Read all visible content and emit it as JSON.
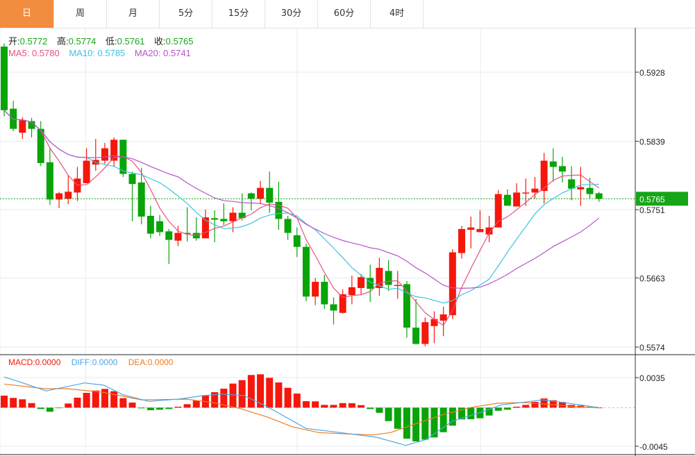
{
  "tabs": [
    {
      "label": "日",
      "active": true
    },
    {
      "label": "周",
      "active": false
    },
    {
      "label": "月",
      "active": false
    },
    {
      "label": "5分",
      "active": false
    },
    {
      "label": "15分",
      "active": false
    },
    {
      "label": "30分",
      "active": false
    },
    {
      "label": "60分",
      "active": false
    },
    {
      "label": "4时",
      "active": false
    }
  ],
  "ohlc_legend": {
    "open_label": "开:",
    "open": "0.5772",
    "high_label": "高:",
    "high": "0.5774",
    "low_label": "低:",
    "low": "0.5761",
    "close_label": "收:",
    "close": "0.5765"
  },
  "ma_legend": {
    "ma5": "MA5: 0.5780",
    "ma10": "MA10: 0.5785",
    "ma20": "MA20: 0.5741"
  },
  "macd_legend": {
    "macd": "MACD:0.0000",
    "diff": "DIFF:0.0000",
    "dea": "DEA:0.0000"
  },
  "colors": {
    "up": "#f5170b",
    "down": "#08a408",
    "ma5": "#ea4f80",
    "ma10": "#3cc4dc",
    "ma20": "#b455c6",
    "diff": "#4aa6e8",
    "dea": "#f07c1c",
    "active_tab": "#f28c3f",
    "last_price_bg": "#16a516"
  },
  "chart_data": [
    {
      "type": "candlestick",
      "y_ticks": [
        "0.5928",
        "0.5839",
        "0.5751",
        "0.5663",
        "0.5574"
      ],
      "ylim": [
        0.5574,
        0.5928
      ],
      "last_price": "0.5765",
      "grid": true,
      "ohlc": [
        [
          0.5961,
          0.5965,
          0.5871,
          0.5879
        ],
        [
          0.5881,
          0.5891,
          0.5852,
          0.5855
        ],
        [
          0.585,
          0.587,
          0.5842,
          0.5866
        ],
        [
          0.5865,
          0.5869,
          0.5844,
          0.5855
        ],
        [
          0.5855,
          0.5865,
          0.5807,
          0.5811
        ],
        [
          0.5812,
          0.5831,
          0.5757,
          0.5764
        ],
        [
          0.5764,
          0.5774,
          0.5753,
          0.5772
        ],
        [
          0.5765,
          0.5795,
          0.5758,
          0.5774
        ],
        [
          0.5773,
          0.5806,
          0.5762,
          0.5791
        ],
        [
          0.5785,
          0.583,
          0.5785,
          0.5814
        ],
        [
          0.5809,
          0.5842,
          0.5801,
          0.5815
        ],
        [
          0.5814,
          0.5837,
          0.581,
          0.583
        ],
        [
          0.5814,
          0.5844,
          0.5806,
          0.5841
        ],
        [
          0.5841,
          0.5841,
          0.5793,
          0.5797
        ],
        [
          0.5797,
          0.58,
          0.5736,
          0.5784
        ],
        [
          0.5786,
          0.5805,
          0.5732,
          0.5742
        ],
        [
          0.5743,
          0.5756,
          0.5714,
          0.572
        ],
        [
          0.5736,
          0.5744,
          0.5717,
          0.5722
        ],
        [
          0.5723,
          0.5726,
          0.5681,
          0.5712
        ],
        [
          0.5711,
          0.573,
          0.5704,
          0.5721
        ],
        [
          0.5721,
          0.5754,
          0.571,
          0.572
        ],
        [
          0.5721,
          0.5741,
          0.5711,
          0.5714
        ],
        [
          0.5714,
          0.5751,
          0.5714,
          0.5741
        ],
        [
          0.574,
          0.575,
          0.5709,
          0.5738
        ],
        [
          0.5739,
          0.5759,
          0.5731,
          0.5736
        ],
        [
          0.5736,
          0.5754,
          0.5722,
          0.5747
        ],
        [
          0.5747,
          0.5772,
          0.5737,
          0.574
        ],
        [
          0.5772,
          0.5773,
          0.575,
          0.5765
        ],
        [
          0.5765,
          0.5788,
          0.5758,
          0.5779
        ],
        [
          0.5779,
          0.58,
          0.5747,
          0.576
        ],
        [
          0.5761,
          0.5787,
          0.5725,
          0.5739
        ],
        [
          0.5739,
          0.5743,
          0.5712,
          0.5721
        ],
        [
          0.5718,
          0.5728,
          0.569,
          0.5703
        ],
        [
          0.5703,
          0.5707,
          0.5633,
          0.5639
        ],
        [
          0.5639,
          0.5663,
          0.5628,
          0.5658
        ],
        [
          0.5658,
          0.5667,
          0.5623,
          0.5629
        ],
        [
          0.5629,
          0.5638,
          0.5603,
          0.5621
        ],
        [
          0.5618,
          0.5648,
          0.5617,
          0.5642
        ],
        [
          0.5641,
          0.5666,
          0.5629,
          0.5651
        ],
        [
          0.565,
          0.5668,
          0.5642,
          0.5664
        ],
        [
          0.5663,
          0.568,
          0.5632,
          0.5649
        ],
        [
          0.565,
          0.5689,
          0.564,
          0.5676
        ],
        [
          0.5672,
          0.5686,
          0.5646,
          0.5654
        ],
        [
          0.5653,
          0.5672,
          0.5636,
          0.5654
        ],
        [
          0.5655,
          0.5659,
          0.5586,
          0.5599
        ],
        [
          0.5599,
          0.5636,
          0.5577,
          0.5578
        ],
        [
          0.5578,
          0.5612,
          0.5575,
          0.5606
        ],
        [
          0.5601,
          0.562,
          0.5579,
          0.561
        ],
        [
          0.5608,
          0.5626,
          0.5588,
          0.5616
        ],
        [
          0.5615,
          0.57,
          0.561,
          0.5696
        ],
        [
          0.5695,
          0.573,
          0.5688,
          0.5726
        ],
        [
          0.5725,
          0.5742,
          0.5701,
          0.5728
        ],
        [
          0.5722,
          0.575,
          0.5722,
          0.5726
        ],
        [
          0.5719,
          0.5743,
          0.5709,
          0.5728
        ],
        [
          0.5728,
          0.5776,
          0.5728,
          0.5771
        ],
        [
          0.577,
          0.5777,
          0.5756,
          0.5756
        ],
        [
          0.5755,
          0.5785,
          0.5755,
          0.5773
        ],
        [
          0.5772,
          0.5791,
          0.5756,
          0.5773
        ],
        [
          0.5773,
          0.5793,
          0.5765,
          0.5778
        ],
        [
          0.5775,
          0.5824,
          0.5759,
          0.5814
        ],
        [
          0.5813,
          0.583,
          0.5787,
          0.5806
        ],
        [
          0.5807,
          0.5819,
          0.5786,
          0.58
        ],
        [
          0.579,
          0.5807,
          0.5763,
          0.5778
        ],
        [
          0.5777,
          0.5806,
          0.5756,
          0.578
        ],
        [
          0.5779,
          0.5792,
          0.5765,
          0.5771
        ],
        [
          0.5772,
          0.5774,
          0.5761,
          0.5765
        ]
      ],
      "moving_averages": [
        5,
        10,
        20
      ]
    },
    {
      "type": "bar+line",
      "y_ticks": [
        "0.0035",
        "-0.0045"
      ],
      "ylim": [
        -0.0045,
        0.0035
      ],
      "macd_hist": [
        0.0014,
        0.00113,
        0.00097,
        0.00053,
        -0.00016,
        -0.00048,
        -3e-05,
        0.00048,
        0.00116,
        0.00172,
        0.00199,
        0.00218,
        0.00191,
        0.0011,
        0.00059,
        -8e-05,
        -0.0003,
        -0.00024,
        -0.00016,
        0.00011,
        0.0004,
        0.00081,
        0.00145,
        0.0018,
        0.00221,
        0.0028,
        0.0032,
        0.0038,
        0.00388,
        0.00347,
        0.00293,
        0.00231,
        0.00164,
        0.00075,
        0.00073,
        0.00032,
        0.00032,
        0.00053,
        0.00051,
        0.00029,
        -0.00016,
        -0.0006,
        -0.00157,
        -0.00246,
        -0.00361,
        -0.00393,
        -0.00372,
        -0.00347,
        -0.00286,
        -0.0021,
        -0.00137,
        -0.00135,
        -0.00124,
        -0.00092,
        -0.00036,
        -0.00024,
        0.00011,
        0.00032,
        0.00067,
        0.00107,
        0.00086,
        0.00065,
        0.00032,
        0.00024,
        0.00011,
        0.0
      ],
      "diff_points": [
        [
          0,
          0.00356
        ],
        [
          1.5,
          0.00307
        ],
        [
          4.6,
          0.00194
        ],
        [
          8.8,
          0.00288
        ],
        [
          10.9,
          0.00261
        ],
        [
          12.9,
          0.00154
        ],
        [
          15.8,
          0.00073
        ],
        [
          19,
          0.00099
        ],
        [
          21.8,
          0.0014
        ],
        [
          23.8,
          0.00158
        ],
        [
          26.2,
          0.0014
        ],
        [
          28.6,
          0.00019
        ],
        [
          33,
          -0.00242
        ],
        [
          36.4,
          -0.00286
        ],
        [
          40.7,
          -0.00345
        ],
        [
          43.9,
          -0.0044
        ],
        [
          46.1,
          -0.00372
        ],
        [
          49,
          -0.00157
        ],
        [
          51.9,
          -0.00062
        ],
        [
          54.3,
          0.00032
        ],
        [
          58.9,
          0.00091
        ],
        [
          62.1,
          0.00045
        ],
        [
          65,
          0
        ]
      ],
      "dea_points": [
        [
          0,
          0.00275
        ],
        [
          4.4,
          0.00221
        ],
        [
          6.8,
          0.00221
        ],
        [
          10.7,
          0.0018
        ],
        [
          15,
          0.00091
        ],
        [
          19.9,
          0.00099
        ],
        [
          22.8,
          0.00059
        ],
        [
          25.7,
          -8e-05
        ],
        [
          28.6,
          -0.00103
        ],
        [
          31.5,
          -0.00223
        ],
        [
          34.4,
          -0.00291
        ],
        [
          40.3,
          -0.00318
        ],
        [
          42.2,
          -0.00291
        ],
        [
          45.1,
          -0.00183
        ],
        [
          48,
          -0.00081
        ],
        [
          50.9,
          0
        ],
        [
          53.9,
          0.00051
        ],
        [
          56.7,
          0.00059
        ],
        [
          59.7,
          0.00037
        ],
        [
          62.6,
          0.00011
        ],
        [
          65,
          0
        ]
      ]
    }
  ]
}
